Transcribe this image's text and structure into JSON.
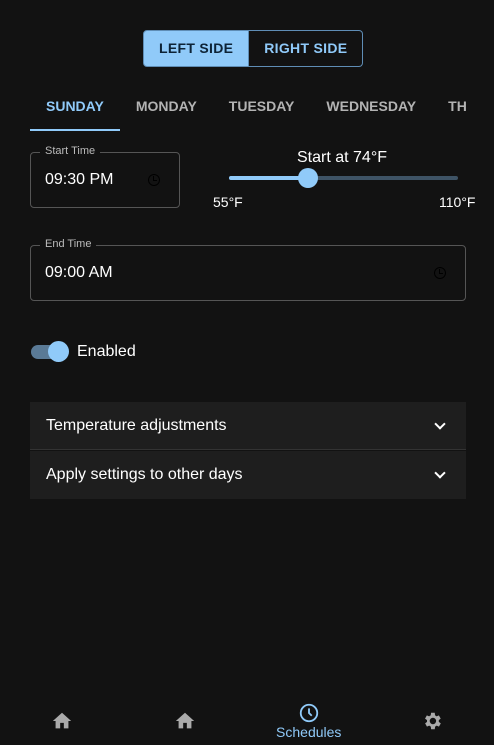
{
  "side_toggle": {
    "left": "LEFT SIDE",
    "right": "RIGHT SIDE"
  },
  "tabs": [
    "SUNDAY",
    "MONDAY",
    "TUESDAY",
    "WEDNESDAY",
    "THURSDAY"
  ],
  "start_time": {
    "label": "Start Time",
    "value": "09:30 PM"
  },
  "end_time": {
    "label": "End Time",
    "value": "09:00 AM"
  },
  "slider": {
    "title": "Start at 74°F",
    "min_label": "55°F",
    "max_label": "110°F",
    "min": 55,
    "max": 110,
    "value": 74
  },
  "enabled": {
    "label": "Enabled",
    "on": true
  },
  "accordions": [
    "Temperature adjustments",
    "Apply settings to other days"
  ],
  "nav": {
    "schedules": "Schedules"
  },
  "colors": {
    "accent": "#90caf9",
    "bg": "#121212"
  }
}
